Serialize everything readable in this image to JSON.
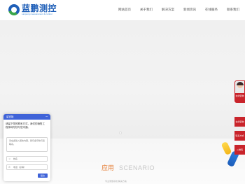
{
  "header": {
    "logo_cn": "蓝鹏测控",
    "logo_en": "Lanpeng measurement & control",
    "nav": [
      "网站首页",
      "关于我们",
      "解决方案",
      "新闻资讯",
      "在线服务",
      "联系我们"
    ]
  },
  "section": {
    "title_cn": "应用",
    "title_en": "SCENARIO",
    "subtitle": "专业测量系统 解决方案"
  },
  "float": {
    "avatar_tag": "在线咨询",
    "buttons": [
      "在线咨询",
      "联系方式",
      "二维码"
    ]
  },
  "chat": {
    "title": "留言板",
    "message": "请留下您的联系方式，我们的销售工程师将尽快与您沟通。",
    "textarea_placeholder": "请在此输入留言内容，我们会尽快与您联系。",
    "name_placeholder": "姓名",
    "phone_placeholder": "电话（必填）",
    "send_label": "提交"
  },
  "colors": {
    "brand_blue": "#1f5fb8",
    "accent_red": "#c9242b",
    "accent_orange": "#e47a30",
    "chat_blue": "#3f63d8"
  }
}
